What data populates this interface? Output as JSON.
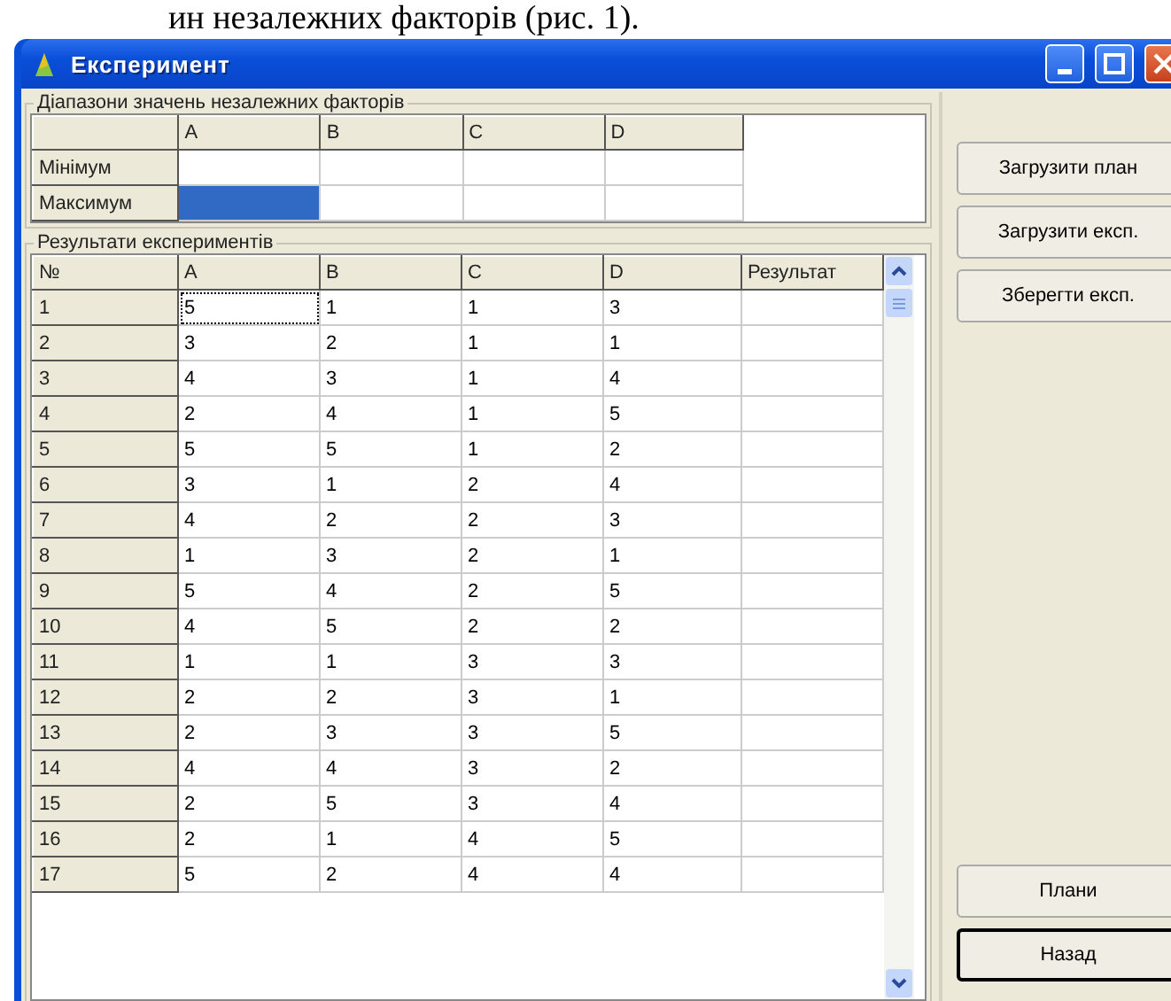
{
  "document_text": "ин незалежних факторів (рис. 1).",
  "window": {
    "title": "Експеримент",
    "controls": [
      {
        "kind": "minimize"
      },
      {
        "kind": "maximize"
      },
      {
        "kind": "close"
      }
    ]
  },
  "ranges": {
    "title": "Діапазони значень незалежних факторів",
    "columns": [
      "A",
      "B",
      "C",
      "D"
    ],
    "rows": [
      {
        "label": "Мінімум",
        "cells": [
          {
            "selected": false
          },
          {
            "selected": false
          },
          {
            "selected": false
          },
          {
            "selected": false
          }
        ]
      },
      {
        "label": "Максимум",
        "cells": [
          {
            "selected": true
          },
          {
            "selected": false
          },
          {
            "selected": false
          },
          {
            "selected": false
          }
        ]
      }
    ]
  },
  "results": {
    "title": "Результати експериментів",
    "number_header": "№",
    "columns": [
      "A",
      "B",
      "C",
      "D",
      "Результат"
    ],
    "rows": [
      {
        "number": "1",
        "cells": [
          {
            "text": "5",
            "focused": true
          },
          {
            "text": "1",
            "focused": false
          },
          {
            "text": "1",
            "focused": false
          },
          {
            "text": "3",
            "focused": false
          }
        ]
      },
      {
        "number": "2",
        "cells": [
          {
            "text": "3",
            "focused": false
          },
          {
            "text": "2",
            "focused": false
          },
          {
            "text": "1",
            "focused": false
          },
          {
            "text": "1",
            "focused": false
          }
        ]
      },
      {
        "number": "3",
        "cells": [
          {
            "text": "4",
            "focused": false
          },
          {
            "text": "3",
            "focused": false
          },
          {
            "text": "1",
            "focused": false
          },
          {
            "text": "4",
            "focused": false
          }
        ]
      },
      {
        "number": "4",
        "cells": [
          {
            "text": "2",
            "focused": false
          },
          {
            "text": "4",
            "focused": false
          },
          {
            "text": "1",
            "focused": false
          },
          {
            "text": "5",
            "focused": false
          }
        ]
      },
      {
        "number": "5",
        "cells": [
          {
            "text": "5",
            "focused": false
          },
          {
            "text": "5",
            "focused": false
          },
          {
            "text": "1",
            "focused": false
          },
          {
            "text": "2",
            "focused": false
          }
        ]
      },
      {
        "number": "6",
        "cells": [
          {
            "text": "3",
            "focused": false
          },
          {
            "text": "1",
            "focused": false
          },
          {
            "text": "2",
            "focused": false
          },
          {
            "text": "4",
            "focused": false
          }
        ]
      },
      {
        "number": "7",
        "cells": [
          {
            "text": "4",
            "focused": false
          },
          {
            "text": "2",
            "focused": false
          },
          {
            "text": "2",
            "focused": false
          },
          {
            "text": "3",
            "focused": false
          }
        ]
      },
      {
        "number": "8",
        "cells": [
          {
            "text": "1",
            "focused": false
          },
          {
            "text": "3",
            "focused": false
          },
          {
            "text": "2",
            "focused": false
          },
          {
            "text": "1",
            "focused": false
          }
        ]
      },
      {
        "number": "9",
        "cells": [
          {
            "text": "5",
            "focused": false
          },
          {
            "text": "4",
            "focused": false
          },
          {
            "text": "2",
            "focused": false
          },
          {
            "text": "5",
            "focused": false
          }
        ]
      },
      {
        "number": "10",
        "cells": [
          {
            "text": "4",
            "focused": false
          },
          {
            "text": "5",
            "focused": false
          },
          {
            "text": "2",
            "focused": false
          },
          {
            "text": "2",
            "focused": false
          }
        ]
      },
      {
        "number": "11",
        "cells": [
          {
            "text": "1",
            "focused": false
          },
          {
            "text": "1",
            "focused": false
          },
          {
            "text": "3",
            "focused": false
          },
          {
            "text": "3",
            "focused": false
          }
        ]
      },
      {
        "number": "12",
        "cells": [
          {
            "text": "2",
            "focused": false
          },
          {
            "text": "2",
            "focused": false
          },
          {
            "text": "3",
            "focused": false
          },
          {
            "text": "1",
            "focused": false
          }
        ]
      },
      {
        "number": "13",
        "cells": [
          {
            "text": "2",
            "focused": false
          },
          {
            "text": "3",
            "focused": false
          },
          {
            "text": "3",
            "focused": false
          },
          {
            "text": "5",
            "focused": false
          }
        ]
      },
      {
        "number": "14",
        "cells": [
          {
            "text": "4",
            "focused": false
          },
          {
            "text": "4",
            "focused": false
          },
          {
            "text": "3",
            "focused": false
          },
          {
            "text": "2",
            "focused": false
          }
        ]
      },
      {
        "number": "15",
        "cells": [
          {
            "text": "2",
            "focused": false
          },
          {
            "text": "5",
            "focused": false
          },
          {
            "text": "3",
            "focused": false
          },
          {
            "text": "4",
            "focused": false
          }
        ]
      },
      {
        "number": "16",
        "cells": [
          {
            "text": "2",
            "focused": false
          },
          {
            "text": "1",
            "focused": false
          },
          {
            "text": "4",
            "focused": false
          },
          {
            "text": "5",
            "focused": false
          }
        ]
      },
      {
        "number": "17",
        "cells": [
          {
            "text": "5",
            "focused": false
          },
          {
            "text": "2",
            "focused": false
          },
          {
            "text": "4",
            "focused": false
          },
          {
            "text": "4",
            "focused": false
          }
        ]
      }
    ]
  },
  "top_buttons": [
    {
      "label": "Загрузити план",
      "default": false
    },
    {
      "label": "Загрузити експ.",
      "default": false
    },
    {
      "label": "Зберегти експ.",
      "default": false
    }
  ],
  "bottom_buttons": [
    {
      "label": "Плани",
      "default": false
    },
    {
      "label": "Назад",
      "default": true
    }
  ]
}
